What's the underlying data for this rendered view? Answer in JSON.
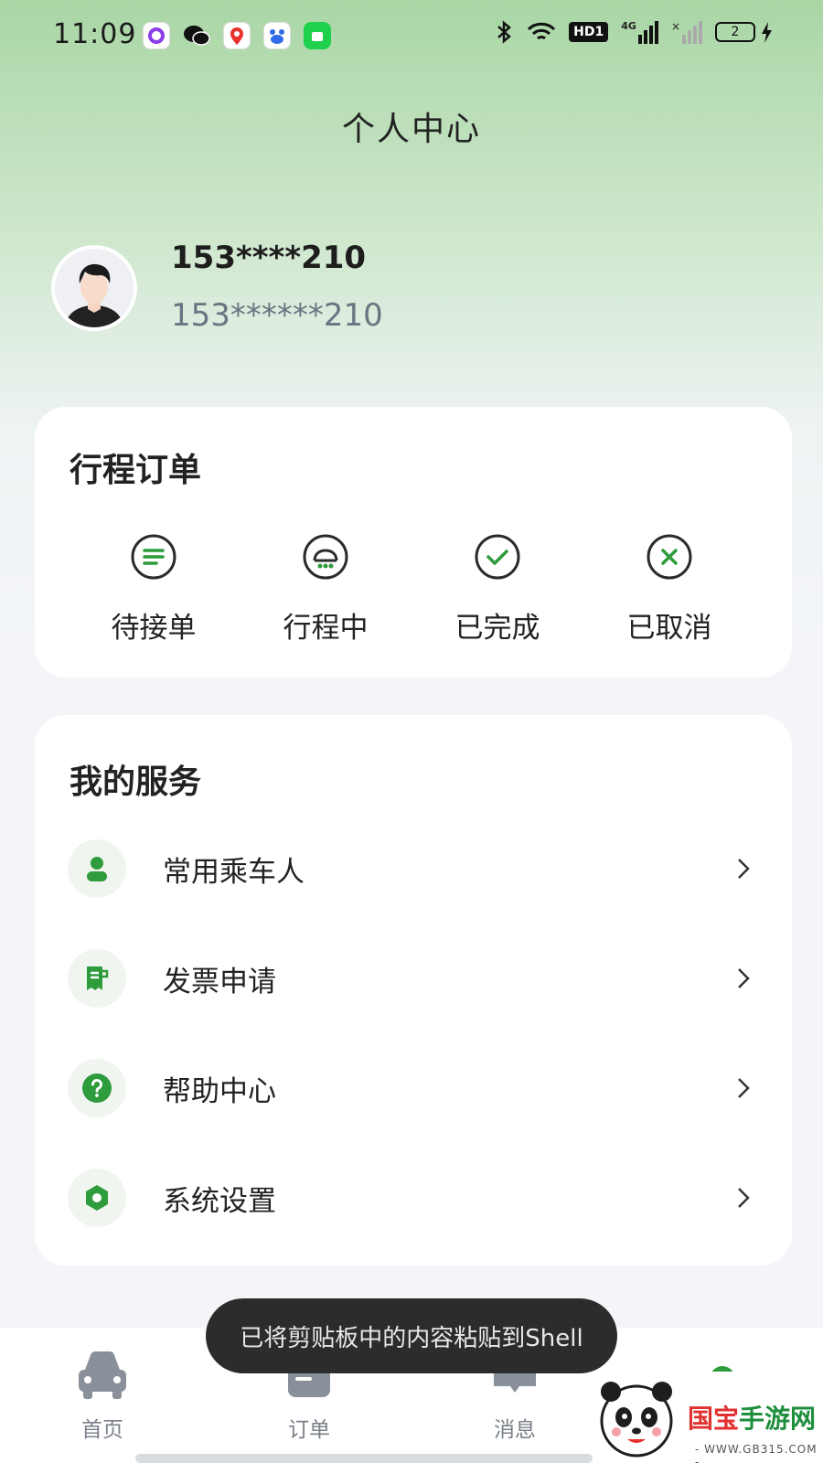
{
  "status_bar": {
    "time": "11:09",
    "battery": "2",
    "hd_label": "HD1",
    "network_label": "4G"
  },
  "header": {
    "title": "个人中心"
  },
  "profile": {
    "username": "153****210",
    "phone": "153******210"
  },
  "orders": {
    "title": "行程订单",
    "items": [
      {
        "label": "待接单",
        "icon": "list-icon"
      },
      {
        "label": "行程中",
        "icon": "car-in-trip-icon"
      },
      {
        "label": "已完成",
        "icon": "check-circle-icon"
      },
      {
        "label": "已取消",
        "icon": "x-circle-icon"
      }
    ]
  },
  "services": {
    "title": "我的服务",
    "items": [
      {
        "label": "常用乘车人",
        "icon": "person-icon"
      },
      {
        "label": "发票申请",
        "icon": "receipt-icon"
      },
      {
        "label": "帮助中心",
        "icon": "help-icon"
      },
      {
        "label": "系统设置",
        "icon": "settings-icon"
      }
    ]
  },
  "bottom_nav": {
    "items": [
      {
        "label": "首页",
        "icon": "car-icon"
      },
      {
        "label": "订单",
        "icon": "order-icon"
      },
      {
        "label": "消息",
        "icon": "message-icon"
      }
    ]
  },
  "toast": {
    "text": "已将剪贴板中的内容粘贴到Shell"
  },
  "watermark": {
    "brand_red": "国宝",
    "brand_green": "手游网",
    "url": "- WWW.GB315.COM -"
  },
  "colors": {
    "accent": "#2e9b3c",
    "icon_dark": "#2b2b2b",
    "muted": "#7a8088"
  }
}
